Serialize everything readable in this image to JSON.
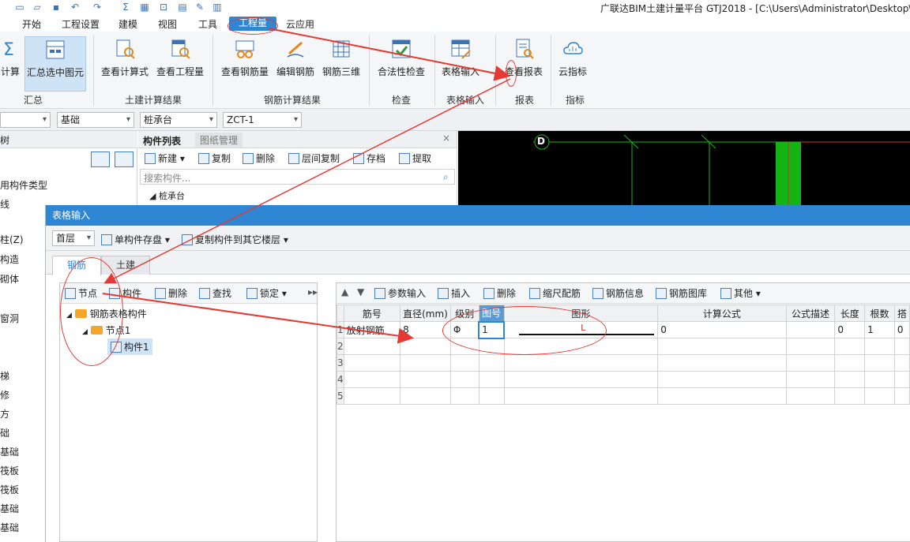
{
  "window": {
    "title": "广联达BIM土建计量平台 GTJ2018 - [C:\\Users\\Administrator\\Desktop\\"
  },
  "menu": {
    "items": [
      "开始",
      "工程设置",
      "建模",
      "视图",
      "工具",
      "工程量",
      "云应用"
    ],
    "active": "工程量"
  },
  "ribbon": {
    "buttons": {
      "calc": "计算",
      "sum_selected": "汇总选中图元",
      "view_formula": "查看计算式",
      "view_quantity": "查看工程量",
      "view_rebar_qty": "查看钢筋量",
      "edit_rebar": "编辑钢筋",
      "rebar_3d": "钢筋三维",
      "legality_check": "合法性检查",
      "table_input": "表格输入",
      "view_report": "查看报表",
      "cloud_index": "云指标"
    },
    "groups": {
      "summary": "汇总",
      "civil_result": "土建计算结果",
      "rebar_result": "钢筋计算结果",
      "check": "检查",
      "table_input": "表格输入",
      "report": "报表",
      "index": "指标"
    }
  },
  "selectors": {
    "s1": "",
    "s2": "基础",
    "s3": "桩承台",
    "s4": "ZCT-1"
  },
  "left_panel": {
    "header": "树",
    "items": [
      "用构件类型",
      "线",
      "柱(Z)",
      "构造",
      "砌体",
      "窗洞",
      "梯",
      "修",
      "方",
      "础",
      "基础",
      "筏板",
      "筏板",
      "基础",
      "基础"
    ]
  },
  "mid_panel": {
    "tabs": [
      "构件列表",
      "图纸管理"
    ],
    "toolbar": [
      "新建",
      "复制",
      "删除",
      "层间复制",
      "存档",
      "提取"
    ],
    "search_placeholder": "搜索构件...",
    "tree_root": "桩承台"
  },
  "canvas": {
    "label": "D"
  },
  "dialog": {
    "title": "表格输入",
    "floor": "首层",
    "save_single": "单构件存盘",
    "copy_floor": "复制构件到其它楼层",
    "tabs": [
      "钢筋",
      "土建"
    ],
    "tree_toolbar": [
      "节点",
      "构件",
      "删除",
      "查找",
      "锁定"
    ],
    "tree": {
      "root": "钢筋表格构件",
      "node": "节点1",
      "leaf": "构件1"
    },
    "grid_toolbar": [
      "参数输入",
      "插入",
      "删除",
      "缩尺配筋",
      "钢筋信息",
      "钢筋图库",
      "其他"
    ],
    "columns": [
      "筋号",
      "直径(mm)",
      "级别",
      "图号",
      "图形",
      "计算公式",
      "公式描述",
      "长度",
      "根数",
      "搭"
    ],
    "rows": [
      {
        "n": "1",
        "name": "放射钢筋",
        "dia": "8",
        "grade": "Φ",
        "fig": "1",
        "shape": "L",
        "formula": "0",
        "desc": "",
        "len": "0",
        "count": "1",
        "lap": "0"
      },
      {
        "n": "2"
      },
      {
        "n": "3"
      },
      {
        "n": "4"
      },
      {
        "n": "5"
      }
    ]
  }
}
